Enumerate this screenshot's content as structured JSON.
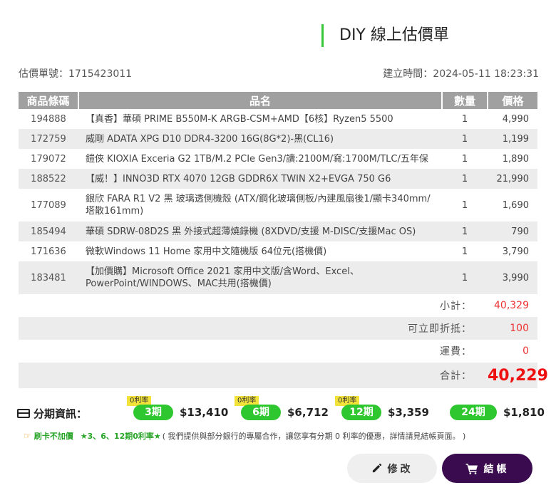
{
  "title": "DIY 線上估價單",
  "meta": {
    "quote_no": "估價單號：1715423011",
    "created": "建立時間：2024-05-11 18:23:31"
  },
  "table": {
    "headers": [
      "商品條碼",
      "品名",
      "數量",
      "價格"
    ],
    "rows": [
      {
        "code": "194888",
        "name": "【真香】華碩 PRIME B550M-K ARGB-CSM+AMD【6核】Ryzen5 5500",
        "qty": "1",
        "price": "4,990"
      },
      {
        "code": "172759",
        "name": "威剛 ADATA XPG D10 DDR4-3200 16G(8G*2)-黑(CL16)",
        "qty": "1",
        "price": "1,199"
      },
      {
        "code": "179072",
        "name": "鎧俠 KIOXIA Exceria G2 1TB/M.2 PCIe Gen3/讀:2100M/寫:1700M/TLC/五年保",
        "qty": "1",
        "price": "1,890"
      },
      {
        "code": "188522",
        "name": "【威！】INNO3D RTX 4070 12GB GDDR6X TWIN X2+EVGA 750 G6",
        "qty": "1",
        "price": "21,990"
      },
      {
        "code": "177089",
        "name": "銀欣 FARA R1 V2 黑 玻璃透側機殼 (ATX/鋼化玻璃側板/內建風扇後1/顯卡340mm/塔散161mm)",
        "qty": "1",
        "price": "1,690"
      },
      {
        "code": "185494",
        "name": "華碩 SDRW-08D2S 黑 外接式超薄燒錄機 (8XDVD/支援 M-DISC/支援Mac OS)",
        "qty": "1",
        "price": "790"
      },
      {
        "code": "171636",
        "name": "微軟Windows 11 Home 家用中文隨機版 64位元(搭機價)",
        "qty": "1",
        "price": "3,790"
      },
      {
        "code": "183481",
        "name": "【加價購】Microsoft Office 2021 家用中文版/含Word、Excel、PowerPoint/WINDOWS、MAC共用(搭機價)",
        "qty": "1",
        "price": "3,990"
      }
    ]
  },
  "summary": {
    "subtotal_label": "小計：",
    "subtotal_value": "40,329",
    "discount_label": "可立即折抵：",
    "discount_value": "100",
    "shipping_label": "運費：",
    "shipping_value": "0",
    "total_label": "合計：",
    "total_value": "40,229"
  },
  "installments": {
    "label": "分期資訊：",
    "plans": [
      {
        "badge": "0利率",
        "term": "3期",
        "amount": "$13,410"
      },
      {
        "badge": "0利率",
        "term": "6期",
        "amount": "$6,712"
      },
      {
        "badge": "0利率",
        "term": "12期",
        "amount": "$3,359"
      },
      {
        "badge": "",
        "term": "24期",
        "amount": "$1,810"
      }
    ]
  },
  "note": {
    "part1": "刷卡不加價",
    "part2": "★3、6、12期0利率★",
    "part3": "( 我們提供與部分銀行的專屬合作，讓您享有分期 0 利率的優惠，詳情請見結帳頁面。 )"
  },
  "buttons": {
    "edit": "修改",
    "checkout": "結帳"
  },
  "colors": {
    "accent_green": "#2fc72f",
    "price_red": "#ee1111",
    "checkout_purple": "#3a0c4f",
    "badge_yellow": "#f3e23a"
  },
  "icons": [
    "credit-card-icon",
    "pointing-hand-icon",
    "pencil-icon",
    "cart-icon"
  ]
}
